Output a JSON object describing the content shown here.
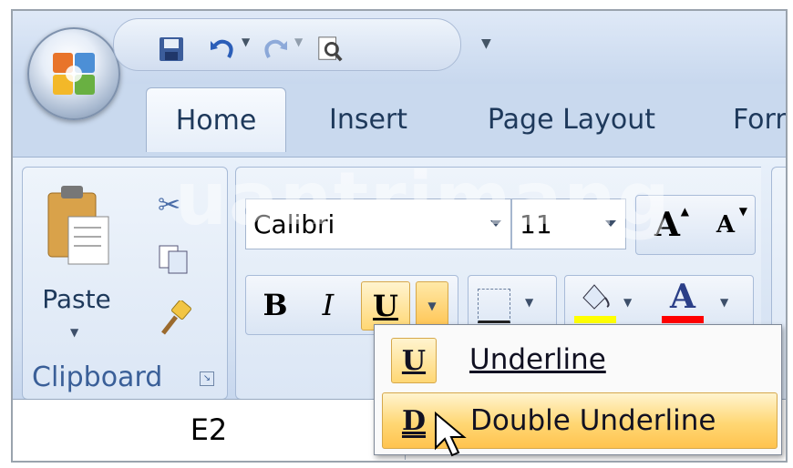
{
  "qat": {
    "icons": [
      "save-icon",
      "undo-icon",
      "redo-icon",
      "print-preview-icon",
      "customize-icon"
    ]
  },
  "tabs": [
    {
      "label": "Home"
    },
    {
      "label": "Insert"
    },
    {
      "label": "Page Layout"
    },
    {
      "label": "Form"
    }
  ],
  "clipboard": {
    "paste_label": "Paste",
    "group_title": "Clipboard"
  },
  "font": {
    "name": "Calibri",
    "size": "11",
    "bold": "B",
    "italic": "I",
    "underline": "U",
    "grow": "A",
    "shrink": "A",
    "font_color_letter": "A"
  },
  "formula": {
    "name_box": "E2"
  },
  "underline_menu": {
    "items": [
      {
        "label": "Underline",
        "icon": "U"
      },
      {
        "label": "Double Underline",
        "icon": "D"
      }
    ]
  },
  "watermark": "uantrimang",
  "colors": {
    "fill_color": "#ffff00",
    "font_color": "#ff0000",
    "accent": "#ffc34f"
  }
}
